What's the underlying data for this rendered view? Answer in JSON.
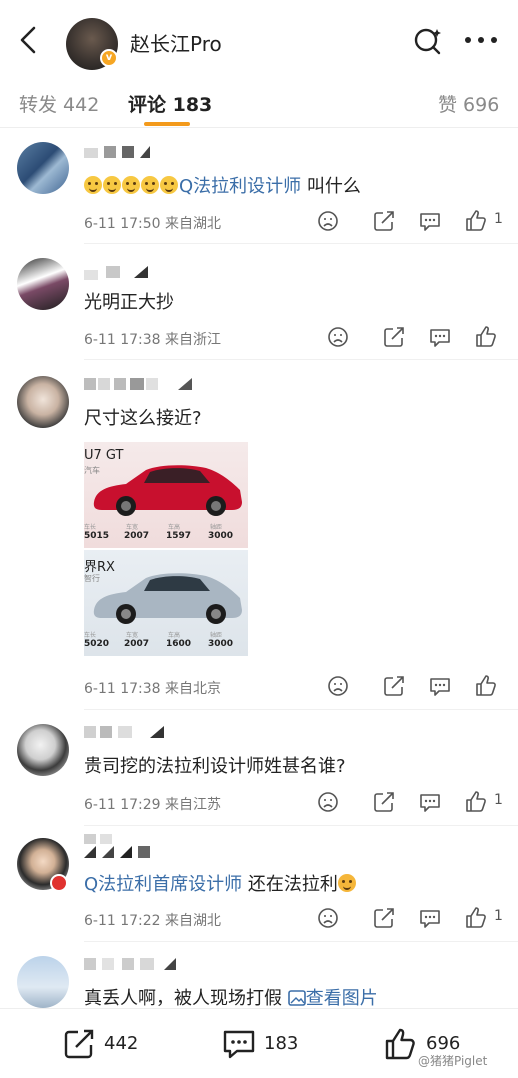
{
  "header": {
    "title": "赵长江Pro"
  },
  "tabs": [
    {
      "label": "转发 442"
    },
    {
      "label": "评论 183"
    },
    {
      "label": "赞 696"
    }
  ],
  "comments": [
    {
      "text_prefix_emojis": 5,
      "link": "Q法拉利设计师",
      "text": " 叫什么",
      "meta": "6-11 17:50  来自湖北",
      "likes": "1"
    },
    {
      "text": "光明正大抄",
      "meta": "6-11 17:38  来自浙江",
      "likes": ""
    },
    {
      "text": "尺寸这么接近?",
      "meta": "6-11 17:38  来自北京",
      "likes": "",
      "images": [
        {
          "name": "U7 GT",
          "sub": "汽车",
          "specs": [
            {
              "label": "车长",
              "value": "5015"
            },
            {
              "label": "车宽",
              "value": "2007"
            },
            {
              "label": "车高",
              "value": "1597"
            },
            {
              "label": "轴距",
              "value": "3000"
            }
          ]
        },
        {
          "name": "界RX",
          "sub": "智行",
          "specs": [
            {
              "label": "车长",
              "value": "5020"
            },
            {
              "label": "车宽",
              "value": "2007"
            },
            {
              "label": "车高",
              "value": "1600"
            },
            {
              "label": "轴距",
              "value": "3000"
            }
          ]
        }
      ]
    },
    {
      "text": "贵司挖的法拉利设计师姓甚名谁?",
      "meta": "6-11 17:29  来自江苏",
      "likes": "1"
    },
    {
      "link": "Q法拉利首席设计师",
      "text": " 还在法拉利",
      "meta": "6-11 17:22  来自湖北",
      "likes": "1"
    },
    {
      "text": "真丢人啊，被人现场打假 ",
      "link": "查看图片"
    }
  ],
  "bottom_bar": {
    "repost_count": "442",
    "comment_count": "183",
    "like_count": "696"
  },
  "watermark": "@猪猪Piglet",
  "colors": {
    "accent": "#f39a1b",
    "link": "#3b6ea8",
    "verify": "#f6a623"
  }
}
